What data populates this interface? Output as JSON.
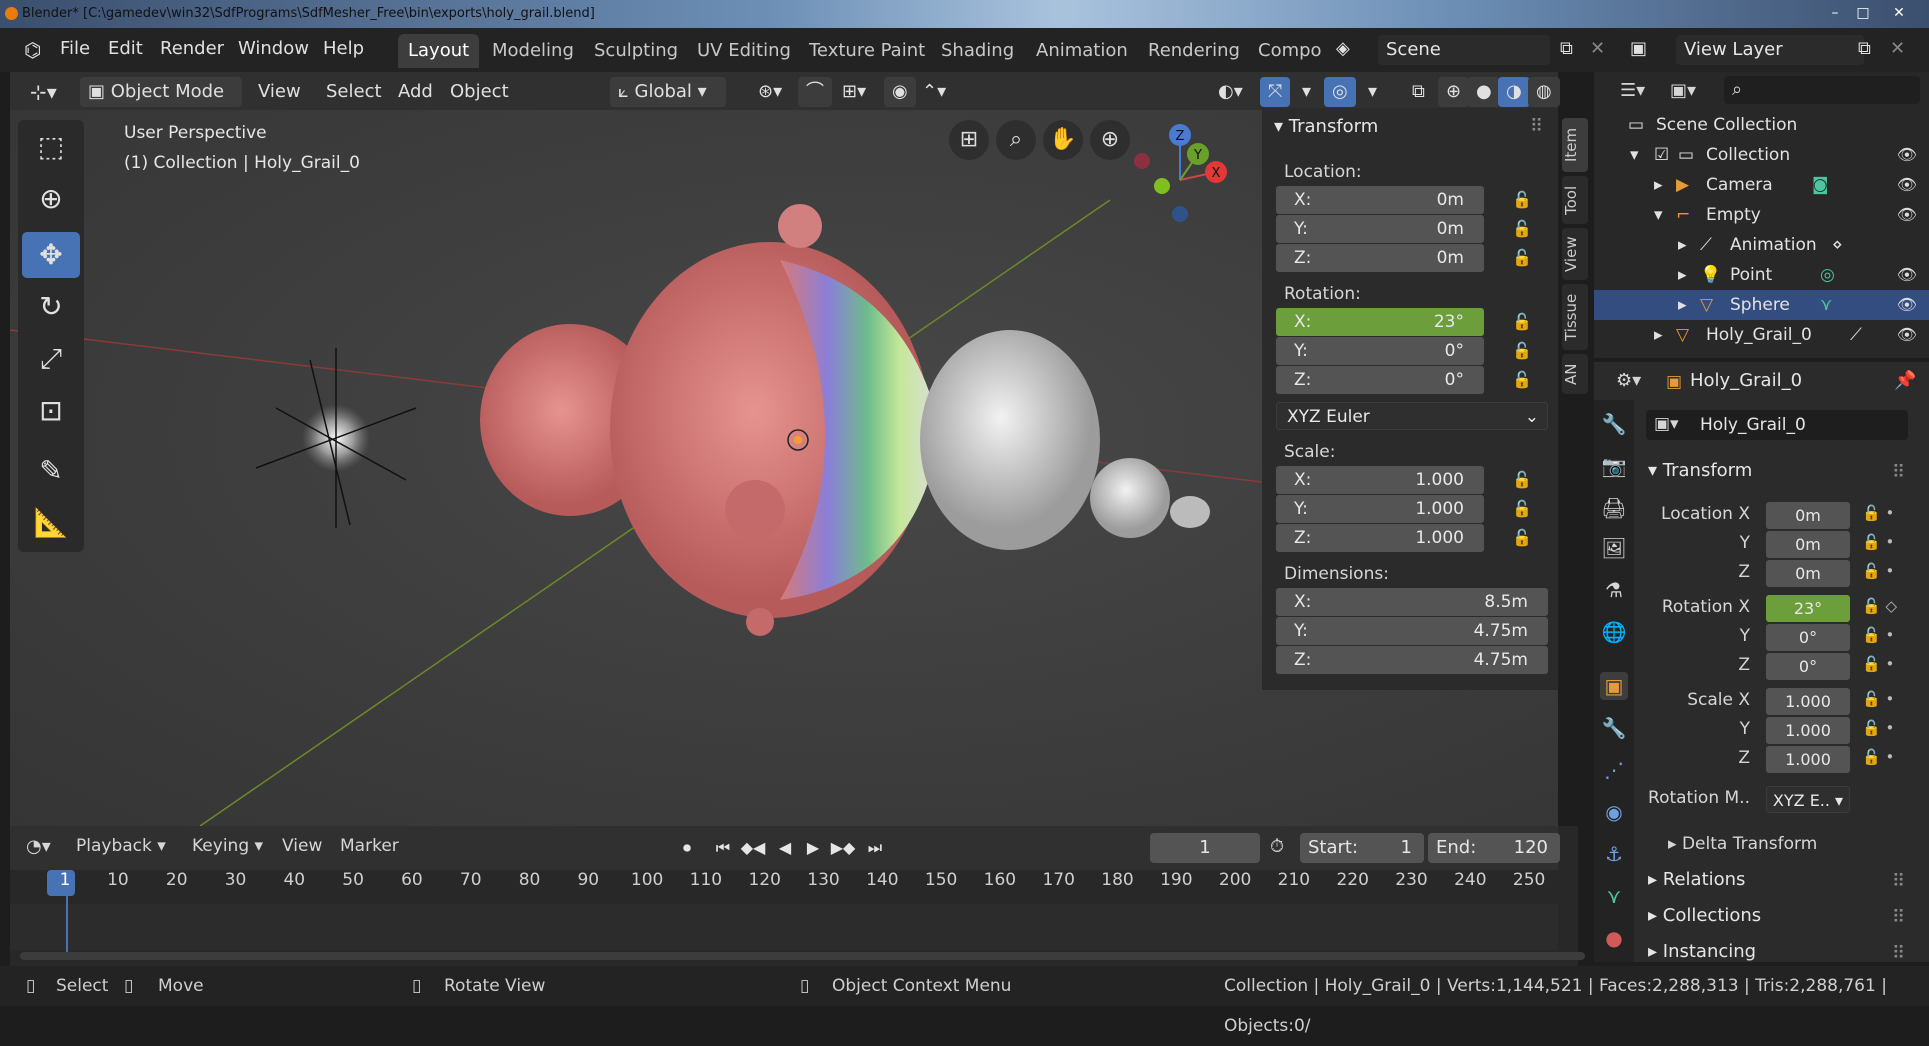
{
  "window": {
    "title": "Blender* [C:\\gamedev\\win32\\SdfPrograms\\SdfMesher_Free\\bin\\exports\\holy_grail.blend]"
  },
  "menu": [
    "File",
    "Edit",
    "Render",
    "Window",
    "Help"
  ],
  "workspaces": [
    "Layout",
    "Modeling",
    "Sculpting",
    "UV Editing",
    "Texture Paint",
    "Shading",
    "Animation",
    "Rendering",
    "Compo"
  ],
  "scene": {
    "name": "Scene",
    "view_layer": "View Layer"
  },
  "viewport_header": {
    "mode": "Object Mode",
    "menus": [
      "View",
      "Select",
      "Add",
      "Object"
    ],
    "orientation": "Global"
  },
  "viewport": {
    "perspective": "User Perspective",
    "collection_info": "(1) Collection | Holy_Grail_0"
  },
  "gizmo": {
    "x": "X",
    "y": "Y",
    "z": "Z"
  },
  "npanel": {
    "title": "Transform",
    "location_label": "Location:",
    "location": [
      {
        "k": "X:",
        "v": "0m"
      },
      {
        "k": "Y:",
        "v": "0m"
      },
      {
        "k": "Z:",
        "v": "0m"
      }
    ],
    "rotation_label": "Rotation:",
    "rotation": [
      {
        "k": "X:",
        "v": "23°"
      },
      {
        "k": "Y:",
        "v": "0°"
      },
      {
        "k": "Z:",
        "v": "0°"
      }
    ],
    "rotation_mode": "XYZ Euler",
    "scale_label": "Scale:",
    "scale": [
      {
        "k": "X:",
        "v": "1.000"
      },
      {
        "k": "Y:",
        "v": "1.000"
      },
      {
        "k": "Z:",
        "v": "1.000"
      }
    ],
    "dimensions_label": "Dimensions:",
    "dimensions": [
      {
        "k": "X:",
        "v": "8.5m"
      },
      {
        "k": "Y:",
        "v": "4.75m"
      },
      {
        "k": "Z:",
        "v": "4.75m"
      }
    ],
    "tabs": [
      "Item",
      "Tool",
      "View",
      "Tissue",
      "AN"
    ]
  },
  "outliner": {
    "root": "Scene Collection",
    "items": [
      {
        "label": "Collection"
      },
      {
        "label": "Camera"
      },
      {
        "label": "Empty"
      },
      {
        "label": "Animation"
      },
      {
        "label": "Point"
      },
      {
        "label": "Sphere"
      },
      {
        "label": "Holy_Grail_0"
      }
    ]
  },
  "properties": {
    "object_name": "Holy_Grail_0",
    "object_field": "Holy_Grail_0",
    "transform_title": "Transform",
    "location_x_label": "Location X",
    "y_label": "Y",
    "z_label": "Z",
    "location": [
      "0m",
      "0m",
      "0m"
    ],
    "rotation_x_label": "Rotation X",
    "rotation": [
      "23°",
      "0°",
      "0°"
    ],
    "scale_x_label": "Scale X",
    "scale": [
      "1.000",
      "1.000",
      "1.000"
    ],
    "rotation_mode_label": "Rotation M..",
    "rotation_mode": "XYZ E..",
    "delta": "Delta Transform",
    "relations": "Relations",
    "collections": "Collections",
    "instancing": "Instancing"
  },
  "timeline": {
    "menus": [
      "Playback",
      "Keying",
      "View",
      "Marker"
    ],
    "current_frame": "1",
    "start_label": "Start:",
    "start": "1",
    "end_label": "End:",
    "end": "120",
    "ticks": [
      "1",
      "10",
      "20",
      "30",
      "40",
      "50",
      "60",
      "70",
      "80",
      "90",
      "100",
      "110",
      "120",
      "130",
      "140",
      "150",
      "160",
      "170",
      "180",
      "190",
      "200",
      "210",
      "220",
      "230",
      "240",
      "250"
    ]
  },
  "status": {
    "select": "Select",
    "move": "Move",
    "rotate": "Rotate View",
    "context": "Object Context Menu",
    "stats": "Collection | Holy_Grail_0 | Verts:1,144,521 | Faces:2,288,313 | Tris:2,288,761 | Objects:0/"
  }
}
